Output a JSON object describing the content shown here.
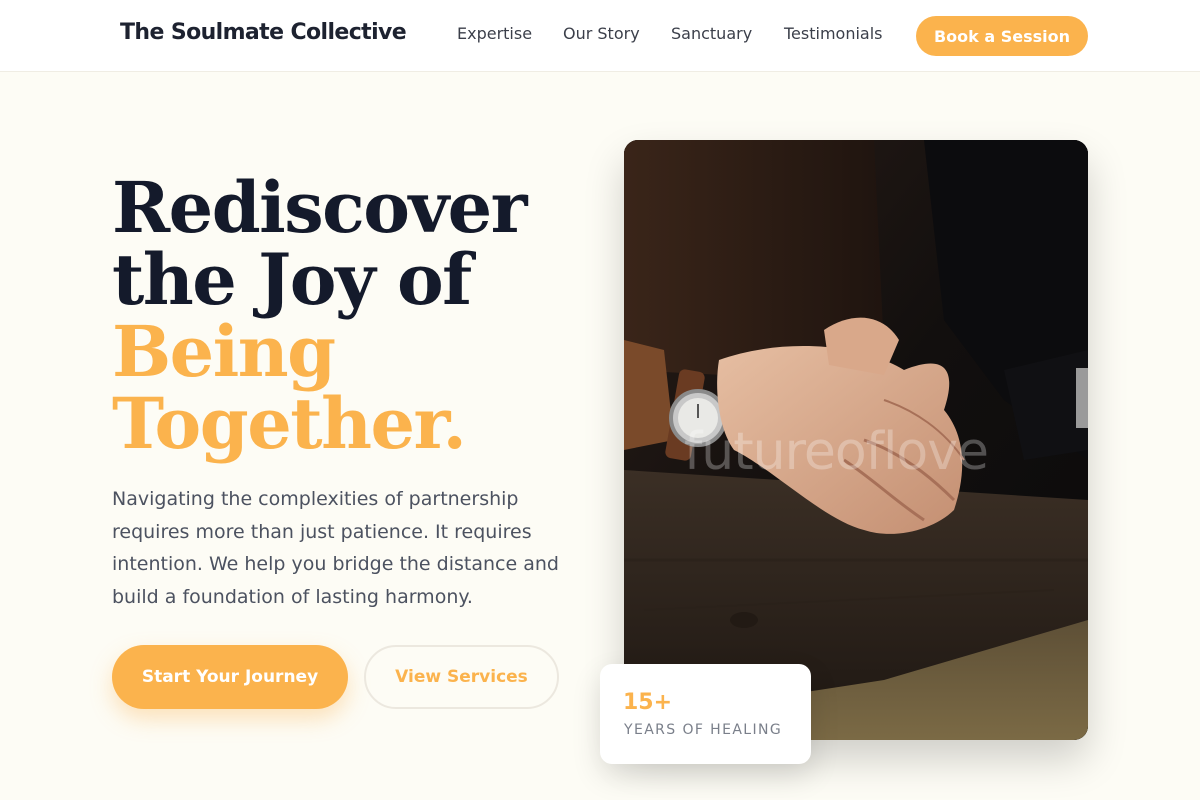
{
  "header": {
    "brand": "The Soulmate Collective",
    "nav": [
      {
        "label": "Expertise"
      },
      {
        "label": "Our Story"
      },
      {
        "label": "Sanctuary"
      },
      {
        "label": "Testimonials"
      }
    ],
    "cta_label": "Book a Session"
  },
  "hero": {
    "headline": {
      "line1": "Rediscover",
      "line2": "the Joy of",
      "line3": "Being",
      "line4": "Together."
    },
    "lede": "Navigating the complexities of partnership requires more than just patience. It requires intention. We help you bridge the distance and build a foundation of lasting harmony.",
    "primary_cta": "Start Your Journey",
    "secondary_cta": "View Services"
  },
  "image": {
    "subject": "clasped-hands-photo",
    "watermark": "futureoflove"
  },
  "stat": {
    "value": "15+",
    "label": "YEARS OF HEALING"
  },
  "colors": {
    "accent": "#fbb34d",
    "ink": "#141a2b",
    "page_bg": "#fdfcf5"
  }
}
